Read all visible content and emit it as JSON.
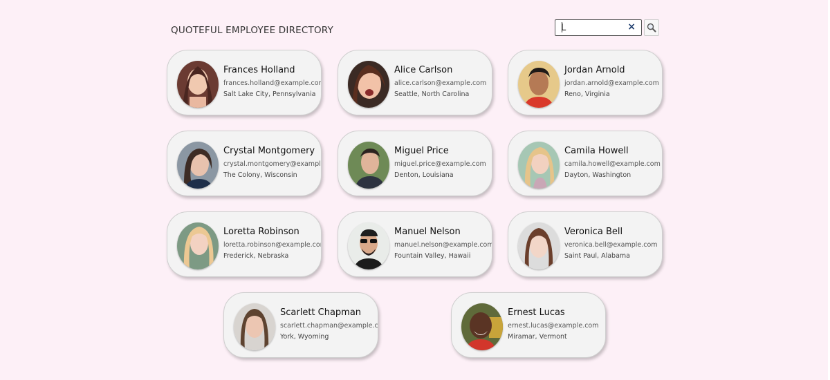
{
  "header": {
    "title": "QUOTEFUL EMPLOYEE DIRECTORY"
  },
  "search": {
    "value": "L",
    "clear_icon": "close-icon",
    "search_icon": "search-icon",
    "clear_glyph": "×"
  },
  "employees": [
    {
      "name": "Frances Holland",
      "email": "frances.holland@example.com",
      "location": "Salt Lake City, Pennsylvania",
      "avatar": "photo-woman-brunette"
    },
    {
      "name": "Alice Carlson",
      "email": "alice.carlson@example.com",
      "location": "Seattle, North Carolina",
      "avatar": "photo-woman-smiling"
    },
    {
      "name": "Jordan Arnold",
      "email": "jordan.arnold@example.com",
      "location": "Reno, Virginia",
      "avatar": "photo-man-red-shirt"
    },
    {
      "name": "Crystal Montgomery",
      "email": "crystal.montgomery@example.com",
      "location": "The Colony, Wisconsin",
      "avatar": "photo-woman-dark-hair"
    },
    {
      "name": "Miguel Price",
      "email": "miguel.price@example.com",
      "location": "Denton, Louisiana",
      "avatar": "photo-man-outdoors"
    },
    {
      "name": "Camila Howell",
      "email": "camila.howell@example.com",
      "location": "Dayton, Washington",
      "avatar": "photo-woman-blonde"
    },
    {
      "name": "Loretta Robinson",
      "email": "loretta.robinson@example.com",
      "location": "Frederick, Nebraska",
      "avatar": "photo-woman-blonde"
    },
    {
      "name": "Manuel Nelson",
      "email": "manuel.nelson@example.com",
      "location": "Fountain Valley, Hawaii",
      "avatar": "photo-man-sunglasses"
    },
    {
      "name": "Veronica Bell",
      "email": "veronica.bell@example.com",
      "location": "Saint Paul, Alabama",
      "avatar": "photo-woman-brunette"
    },
    {
      "name": "Scarlett Chapman",
      "email": "scarlett.chapman@example.com",
      "location": "York, Wyoming",
      "avatar": "photo-woman-long-hair"
    },
    {
      "name": "Ernest Lucas",
      "email": "ernest.lucas@example.com",
      "location": "Miramar, Vermont",
      "avatar": "photo-man-smiling"
    }
  ],
  "colors": {
    "background": "#fdf0f7",
    "card": "#f3f3f3",
    "clear_icon": "#1f3e6e"
  }
}
